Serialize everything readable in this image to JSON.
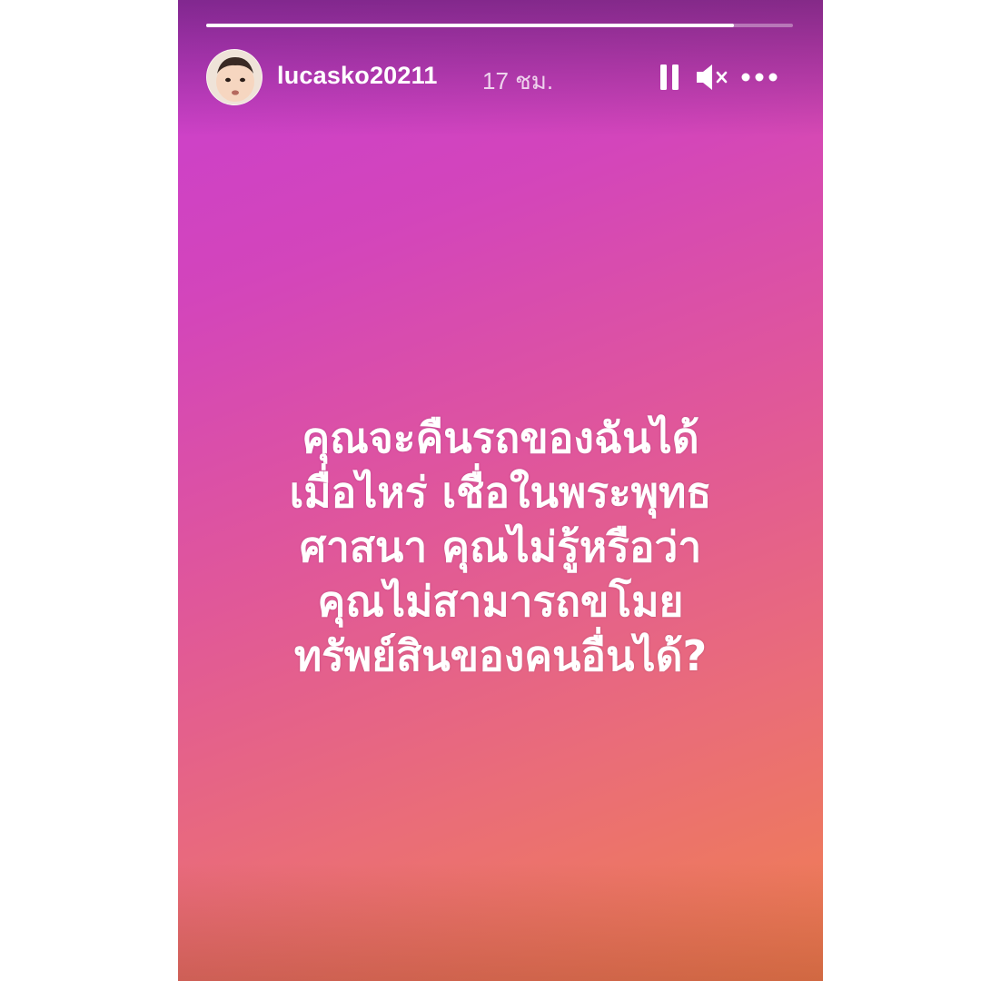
{
  "story": {
    "progress": 0.9,
    "username": "lucasko20211",
    "timestamp": "17 ชม.",
    "controls": {
      "pause_icon": "pause-icon",
      "mute_icon": "speaker-muted-icon",
      "more_icon": "more-horizontal-icon"
    },
    "message_lines": [
      "คุณจะคืนรถของฉันได้",
      "เมื่อไหร่  เชื่อในพระพุทธ",
      "ศาสนา คุณไม่รู้หรือว่า",
      "คุณไม่สามารถขโมย",
      "ทรัพย์สินของคนอื่นได้?"
    ]
  },
  "colors": {
    "gradient_top": "#c93fd0",
    "gradient_mid": "#e0579a",
    "gradient_bottom": "#f0804f",
    "text": "#ffffff"
  }
}
